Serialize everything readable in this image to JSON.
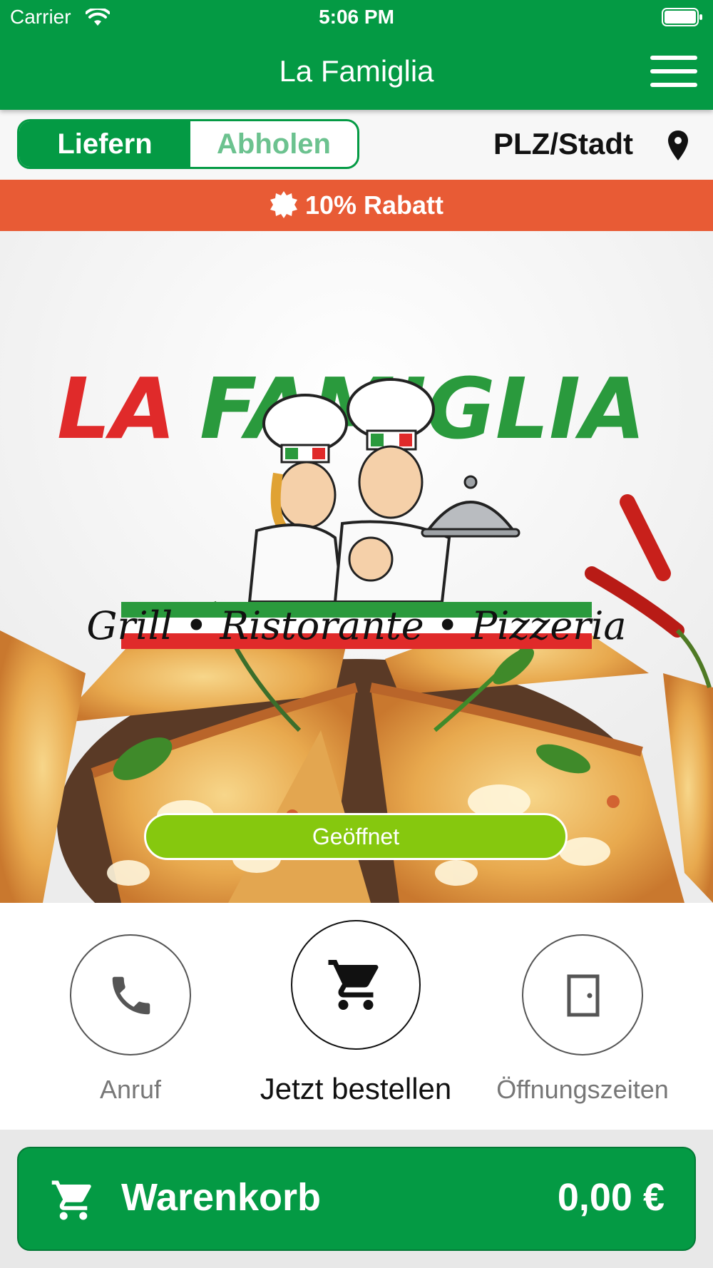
{
  "status_bar": {
    "carrier": "Carrier",
    "time": "5:06 PM"
  },
  "nav": {
    "title": "La Famiglia"
  },
  "delivery_mode": {
    "deliver_label": "Liefern",
    "pickup_label": "Abholen",
    "selected": "Liefern"
  },
  "location": {
    "label": "PLZ/Stadt"
  },
  "discount": {
    "label": "10% Rabatt"
  },
  "hero": {
    "logo": {
      "line1_red": "LA",
      "line1_green": "FAMIGLIA",
      "tagline": "Grill • Ristorante • Pizzeria"
    }
  },
  "status_button": {
    "label": "Geöffnet"
  },
  "actions": {
    "call": {
      "label": "Anruf",
      "icon": "phone-icon"
    },
    "order": {
      "label": "Jetzt bestellen",
      "icon": "cart-icon"
    },
    "hours": {
      "label": "Öffnungszeiten",
      "icon": "door-icon"
    }
  },
  "cart": {
    "label": "Warenkorb",
    "total": "0,00 €"
  },
  "colors": {
    "brand_green": "#049a44",
    "discount_orange": "#e85b35",
    "open_green": "#86c80e",
    "pickup_text": "#6cc28f"
  }
}
